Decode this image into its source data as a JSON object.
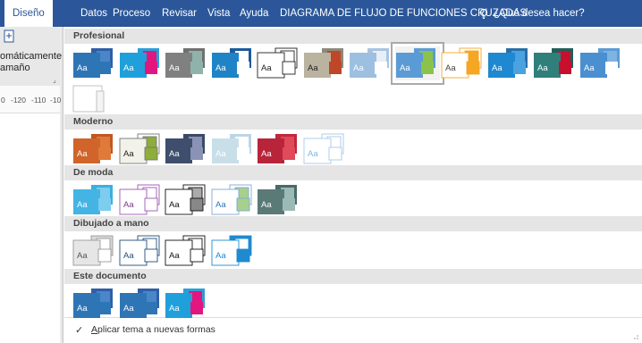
{
  "tabs": [
    {
      "label": "Diseño",
      "active": true
    },
    {
      "label": "Datos"
    },
    {
      "label": "Proceso"
    },
    {
      "label": "Revisar"
    },
    {
      "label": "Vista"
    },
    {
      "label": "Ayuda"
    },
    {
      "label": "DIAGRAMA DE FLUJO DE FUNCIONES CRUZADAS"
    }
  ],
  "tell_me": "¿Qué desea hacer?",
  "left_panel": {
    "line1": "omáticamente",
    "line2": "amaño",
    "ruler": [
      "0",
      "-120",
      "-110",
      "-10"
    ]
  },
  "gallery": {
    "sections": [
      {
        "title": "Profesional",
        "themes": [
          {
            "back": "#2e5fa8",
            "mid": "#4a86c8",
            "front": "#2e75b6",
            "accent": "#2e75b6",
            "text": "#ffffff"
          },
          {
            "back": "#2a9fd8",
            "mid": "#e3157f",
            "front": "#1fa0da",
            "accent": "#e3157f",
            "text": "#ffffff"
          },
          {
            "back": "#707070",
            "mid": "#8fb3aa",
            "front": "#808080",
            "accent": "#8fb3aa",
            "text": "#ffffff"
          },
          {
            "back": "#1d5b9b",
            "mid": "#ffffff",
            "front": "#1f84c6",
            "accent": "#ffffff",
            "text": "#ffffff"
          },
          {
            "back": "#ffffff",
            "mid": "#ffffff",
            "front": "#ffffff",
            "accent": "#ffffff",
            "text": "#222222",
            "line": "#222222"
          },
          {
            "back": "#8a8a7a",
            "mid": "#c0462a",
            "front": "#b9b3a0",
            "accent": "#c0462a",
            "text": "#222222"
          },
          {
            "back": "#a8c4e0",
            "mid": "#e8eef6",
            "front": "#9dbfe0",
            "accent": "#ffffff",
            "text": "#ffffff"
          },
          {
            "back": "#5b9bd5",
            "mid": "#8bc34a",
            "front": "#5b9bd5",
            "accent": "#8bc34a",
            "text": "#ffffff"
          },
          {
            "back": "#ffffff",
            "mid": "#f5a623",
            "front": "#ffffff",
            "accent": "#f5a623",
            "text": "#444444",
            "line": "#f5a623"
          },
          {
            "back": "#2a6fa8",
            "mid": "#4aa3df",
            "front": "#1e88d0",
            "accent": "#4aa3df",
            "text": "#ffffff"
          },
          {
            "back": "#1f5f5b",
            "mid": "#c8102e",
            "front": "#2f7f7a",
            "accent": "#c8102e",
            "text": "#ffffff"
          },
          {
            "back": "#5b9bd5",
            "mid": "#7fb3e0",
            "front": "#4a8fd0",
            "accent": "#ffffff",
            "text": "#ffffff"
          },
          {
            "back": "#ffffff",
            "mid": "#ffffff",
            "front": "#ffffff",
            "accent": "#ffffff",
            "text": "#ffffff",
            "line": "#bbbbbb"
          }
        ]
      },
      {
        "title": "Moderno",
        "themes": [
          {
            "back": "#c0581f",
            "mid": "#e07a3a",
            "front": "#d0642a",
            "accent": "#e07a3a",
            "text": "#ffffff"
          },
          {
            "back": "#ffffff",
            "mid": "#8dae3a",
            "front": "#f2f2ea",
            "accent": "#8dae3a",
            "text": "#222222",
            "line": "#777777"
          },
          {
            "back": "#3a4a66",
            "mid": "#8a93b5",
            "front": "#3e4e6c",
            "accent": "#8a93b5",
            "text": "#ffffff"
          },
          {
            "back": "#bcd6e4",
            "mid": "#ffffff",
            "front": "#c8dfe9",
            "accent": "#ffffff",
            "text": "#ffffff"
          },
          {
            "back": "#c0283a",
            "mid": "#e04a5a",
            "front": "#b8253a",
            "accent": "#e04a5a",
            "text": "#ffffff"
          },
          {
            "back": "#ffffff",
            "mid": "#ffffff",
            "front": "#ffffff",
            "accent": "#ffffff",
            "text": "#7fb3e0",
            "line": "#a8c8e8"
          }
        ]
      },
      {
        "title": "De moda",
        "themes": [
          {
            "back": "#3ab0e0",
            "mid": "#7ccdee",
            "front": "#44b4e4",
            "accent": "#7ccdee",
            "text": "#ffffff"
          },
          {
            "back": "#ffffff",
            "mid": "#ffffff",
            "front": "#ffffff",
            "accent": "#ffffff",
            "text": "#7a3c8a",
            "line": "#9a5ab0"
          },
          {
            "back": "#ffffff",
            "mid": "#aaaaaa",
            "front": "#ffffff",
            "accent": "#888888",
            "text": "#111111",
            "line": "#111111"
          },
          {
            "back": "#ffffff",
            "mid": "#a8d08d",
            "front": "#ffffff",
            "accent": "#a8d08d",
            "text": "#2e75b6",
            "line": "#7fa8d8"
          },
          {
            "back": "#4a6a6a",
            "mid": "#9bbab5",
            "front": "#5a7a78",
            "accent": "#9bbab5",
            "text": "#ffffff"
          }
        ]
      },
      {
        "title": "Dibujado a mano",
        "themes": [
          {
            "back": "#d8d8d8",
            "mid": "#ffffff",
            "front": "#e6e6e6",
            "accent": "#ffffff",
            "text": "#555555",
            "line": "#999999"
          },
          {
            "back": "#ffffff",
            "mid": "#ffffff",
            "front": "#ffffff",
            "accent": "#ffffff",
            "text": "#1f4e79",
            "line": "#1f4e79"
          },
          {
            "back": "#ffffff",
            "mid": "#ffffff",
            "front": "#ffffff",
            "accent": "#ffffff",
            "text": "#111111",
            "line": "#111111"
          },
          {
            "back": "#1f8ad0",
            "mid": "#ffffff",
            "front": "#ffffff",
            "accent": "#1f8ad0",
            "text": "#1f8ad0",
            "line": "#1f8ad0"
          }
        ]
      },
      {
        "title": "Este documento",
        "themes": [
          {
            "back": "#2e5fa8",
            "mid": "#4a86c8",
            "front": "#2e75b6",
            "accent": "#2e75b6",
            "text": "#ffffff"
          },
          {
            "back": "#2e5fa8",
            "mid": "#4a86c8",
            "front": "#2e75b6",
            "accent": "#2e75b6",
            "text": "#ffffff"
          },
          {
            "back": "#2a9fd8",
            "mid": "#e3157f",
            "front": "#1fa0da",
            "accent": "#e3157f",
            "text": "#ffffff"
          }
        ]
      }
    ],
    "selected": {
      "section": 0,
      "index": 7
    },
    "thumb_text": "Aa",
    "footer": {
      "check": "✓",
      "label": "Aplicar tema a nuevas formas"
    }
  }
}
